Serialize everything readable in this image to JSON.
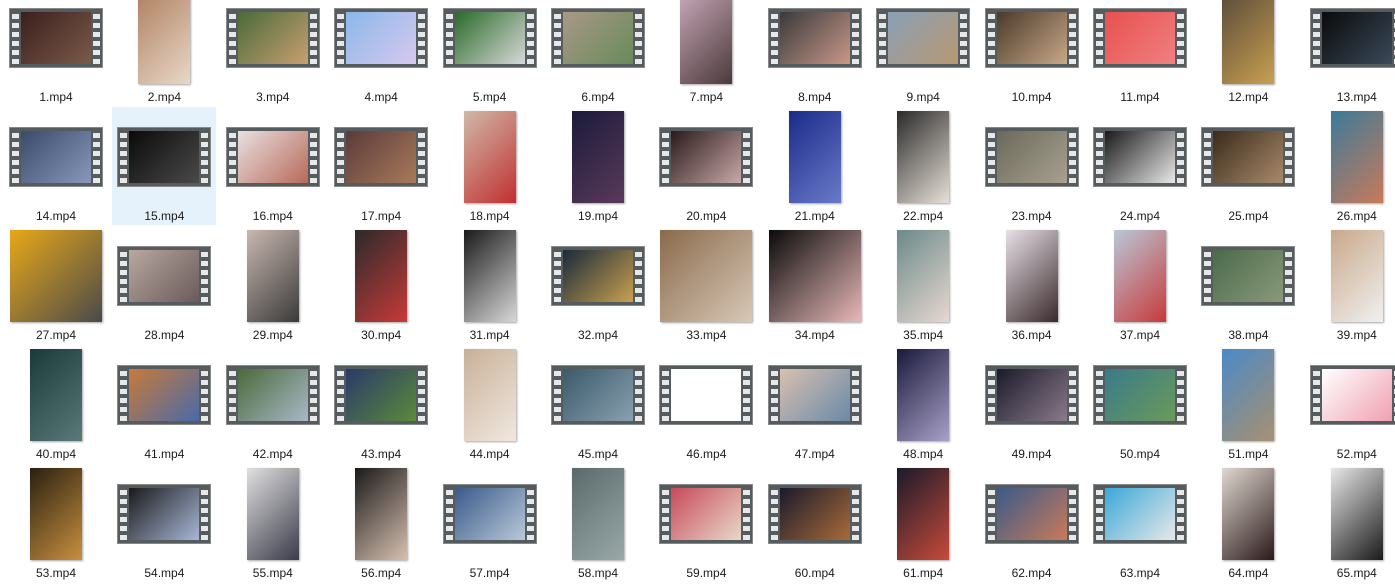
{
  "files": [
    {
      "label": "1.mp4",
      "kind": "film",
      "c1": "#3a1f1c",
      "c2": "#7a5a4a"
    },
    {
      "label": "2.mp4",
      "kind": "portrait",
      "c1": "#b08060",
      "c2": "#e8d8c8"
    },
    {
      "label": "3.mp4",
      "kind": "film",
      "c1": "#4a6a3a",
      "c2": "#c8a070"
    },
    {
      "label": "4.mp4",
      "kind": "film",
      "c1": "#8ab8e8",
      "c2": "#d8c8f0"
    },
    {
      "label": "5.mp4",
      "kind": "film",
      "c1": "#2a6a2a",
      "c2": "#d8d8d8"
    },
    {
      "label": "6.mp4",
      "kind": "film",
      "c1": "#a89888",
      "c2": "#6a8a5a"
    },
    {
      "label": "7.mp4",
      "kind": "portrait",
      "c1": "#c8a8b8",
      "c2": "#4a3a3a"
    },
    {
      "label": "8.mp4",
      "kind": "film",
      "c1": "#3a3a3a",
      "c2": "#c89888"
    },
    {
      "label": "9.mp4",
      "kind": "film",
      "c1": "#8aa0b8",
      "c2": "#b89870"
    },
    {
      "label": "10.mp4",
      "kind": "film",
      "c1": "#4a3a2a",
      "c2": "#c8a888"
    },
    {
      "label": "11.mp4",
      "kind": "film",
      "c1": "#e85050",
      "c2": "#f08080"
    },
    {
      "label": "12.mp4",
      "kind": "portrait",
      "c1": "#5a4a3a",
      "c2": "#c8a050"
    },
    {
      "label": "13.mp4",
      "kind": "film",
      "c1": "#0a0a0a",
      "c2": "#3a4a5a"
    },
    {
      "label": "14.mp4",
      "kind": "film",
      "c1": "#3a4a6a",
      "c2": "#8898b8"
    },
    {
      "label": "15.mp4",
      "kind": "film",
      "c1": "#0a0a0a",
      "c2": "#4a4a4a",
      "selected": true
    },
    {
      "label": "16.mp4",
      "kind": "film",
      "c1": "#e8e0e0",
      "c2": "#b86a5a"
    },
    {
      "label": "17.mp4",
      "kind": "film",
      "c1": "#5a3a3a",
      "c2": "#a87a5a"
    },
    {
      "label": "18.mp4",
      "kind": "portrait",
      "c1": "#d0b8a8",
      "c2": "#c03030"
    },
    {
      "label": "19.mp4",
      "kind": "portrait",
      "c1": "#1a1a3a",
      "c2": "#5a3a5a"
    },
    {
      "label": "20.mp4",
      "kind": "film",
      "c1": "#2a1a1a",
      "c2": "#c8a8a8"
    },
    {
      "label": "21.mp4",
      "kind": "portrait",
      "c1": "#1a2a8a",
      "c2": "#6a7ac8"
    },
    {
      "label": "22.mp4",
      "kind": "portrait",
      "c1": "#2a2a2a",
      "c2": "#e8e0d8"
    },
    {
      "label": "23.mp4",
      "kind": "film",
      "c1": "#6a6a5a",
      "c2": "#a8a090"
    },
    {
      "label": "24.mp4",
      "kind": "film",
      "c1": "#1a1a1a",
      "c2": "#e8e8e8"
    },
    {
      "label": "25.mp4",
      "kind": "film",
      "c1": "#3a2a1a",
      "c2": "#a88a6a"
    },
    {
      "label": "26.mp4",
      "kind": "portrait",
      "c1": "#3a7a9a",
      "c2": "#c87a5a"
    },
    {
      "label": "27.mp4",
      "kind": "square",
      "c1": "#e8a818",
      "c2": "#4a4a4a"
    },
    {
      "label": "28.mp4",
      "kind": "film",
      "c1": "#b8a8a0",
      "c2": "#6a5a5a"
    },
    {
      "label": "29.mp4",
      "kind": "portrait",
      "c1": "#c8b8b0",
      "c2": "#3a3a3a"
    },
    {
      "label": "30.mp4",
      "kind": "portrait",
      "c1": "#2a2a2a",
      "c2": "#c83a3a"
    },
    {
      "label": "31.mp4",
      "kind": "portrait",
      "c1": "#1a1a1a",
      "c2": "#d8d8d8"
    },
    {
      "label": "32.mp4",
      "kind": "film",
      "c1": "#1a2a3a",
      "c2": "#c8a050"
    },
    {
      "label": "33.mp4",
      "kind": "square",
      "c1": "#8a6a4a",
      "c2": "#d8c8b8"
    },
    {
      "label": "34.mp4",
      "kind": "square",
      "c1": "#0a0a0a",
      "c2": "#e8b8b8"
    },
    {
      "label": "35.mp4",
      "kind": "portrait",
      "c1": "#6a8a8a",
      "c2": "#e8d8d0"
    },
    {
      "label": "36.mp4",
      "kind": "portrait",
      "c1": "#e8e0e8",
      "c2": "#3a2a2a"
    },
    {
      "label": "37.mp4",
      "kind": "portrait",
      "c1": "#b8c8d8",
      "c2": "#c83a3a"
    },
    {
      "label": "38.mp4",
      "kind": "film",
      "c1": "#4a6a4a",
      "c2": "#8a9a7a"
    },
    {
      "label": "39.mp4",
      "kind": "portrait",
      "c1": "#c8a888",
      "c2": "#f0f0f0"
    },
    {
      "label": "40.mp4",
      "kind": "portrait",
      "c1": "#1a3a3a",
      "c2": "#5a7a7a"
    },
    {
      "label": "41.mp4",
      "kind": "film",
      "c1": "#c87a3a",
      "c2": "#4a6aa8"
    },
    {
      "label": "42.mp4",
      "kind": "film",
      "c1": "#4a6a3a",
      "c2": "#a8b8c8"
    },
    {
      "label": "43.mp4",
      "kind": "film",
      "c1": "#2a3a6a",
      "c2": "#5a8a3a"
    },
    {
      "label": "44.mp4",
      "kind": "portrait",
      "c1": "#c8b098",
      "c2": "#f0e8e0"
    },
    {
      "label": "45.mp4",
      "kind": "film",
      "c1": "#3a5a6a",
      "c2": "#8aa0b0"
    },
    {
      "label": "46.mp4",
      "kind": "film",
      "c1": "#ffffff",
      "c2": "#ffffff"
    },
    {
      "label": "47.mp4",
      "kind": "film",
      "c1": "#d8c0b0",
      "c2": "#6a8aa8"
    },
    {
      "label": "48.mp4",
      "kind": "portrait",
      "c1": "#1a1a3a",
      "c2": "#a8a0c8"
    },
    {
      "label": "49.mp4",
      "kind": "film",
      "c1": "#1a1a2a",
      "c2": "#8a7a8a"
    },
    {
      "label": "50.mp4",
      "kind": "film",
      "c1": "#3a7a8a",
      "c2": "#6a9a5a"
    },
    {
      "label": "51.mp4",
      "kind": "portrait",
      "c1": "#4a8ac8",
      "c2": "#a89070"
    },
    {
      "label": "52.mp4",
      "kind": "film",
      "c1": "#ffffff",
      "c2": "#f0a0b0"
    },
    {
      "label": "53.mp4",
      "kind": "portrait",
      "c1": "#2a2010",
      "c2": "#c89040"
    },
    {
      "label": "54.mp4",
      "kind": "film",
      "c1": "#1a1a1a",
      "c2": "#a8b8d8"
    },
    {
      "label": "55.mp4",
      "kind": "portrait",
      "c1": "#e0e0e0",
      "c2": "#3a3a4a"
    },
    {
      "label": "56.mp4",
      "kind": "portrait",
      "c1": "#1a1a1a",
      "c2": "#d8c0b0"
    },
    {
      "label": "57.mp4",
      "kind": "film",
      "c1": "#3a5a8a",
      "c2": "#b8c8d8"
    },
    {
      "label": "58.mp4",
      "kind": "portrait",
      "c1": "#5a6a6a",
      "c2": "#9aa8a8"
    },
    {
      "label": "59.mp4",
      "kind": "film",
      "c1": "#c84a5a",
      "c2": "#e8d8c8"
    },
    {
      "label": "60.mp4",
      "kind": "film",
      "c1": "#1a1a2a",
      "c2": "#a86a3a"
    },
    {
      "label": "61.mp4",
      "kind": "portrait",
      "c1": "#1a1a2a",
      "c2": "#c84a3a"
    },
    {
      "label": "62.mp4",
      "kind": "film",
      "c1": "#3a5a8a",
      "c2": "#c87a5a"
    },
    {
      "label": "63.mp4",
      "kind": "film",
      "c1": "#3aa8d8",
      "c2": "#e8e8e8"
    },
    {
      "label": "64.mp4",
      "kind": "portrait",
      "c1": "#e0d8d0",
      "c2": "#2a1a1a"
    },
    {
      "label": "65.mp4",
      "kind": "portrait",
      "c1": "#e8e8e8",
      "c2": "#1a1a1a"
    }
  ]
}
